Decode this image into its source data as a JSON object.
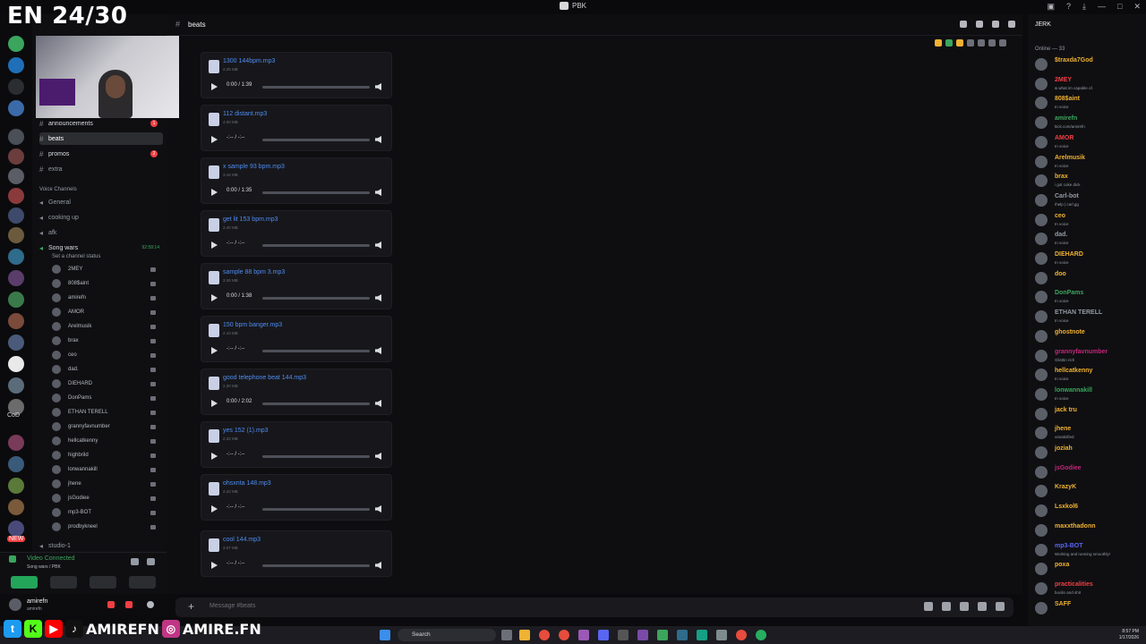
{
  "window": {
    "title": "PBK"
  },
  "overlay": {
    "title": "EN 24/30",
    "socials": [
      "AMIREFN",
      "AMIRE.FN"
    ]
  },
  "servers": {
    "labels": [
      "CoD",
      "NEW"
    ]
  },
  "sidebar": {
    "server_name": "PBK",
    "text_channels": [
      {
        "name": "announcements",
        "badge": "1"
      },
      {
        "name": "beats",
        "badge": ""
      },
      {
        "name": "promos",
        "badge": "2"
      },
      {
        "name": "extra",
        "badge": ""
      }
    ],
    "voice_header": "Voice Channels",
    "voice_channels": [
      "General",
      "cooking up",
      "afk"
    ],
    "song_wars": {
      "name": "Song wars",
      "timer": "92:58:14",
      "status": "Set a channel status"
    },
    "voice_users": [
      "2MEY",
      "808$aint",
      "amirefn",
      "AMOR",
      "Arelmusik",
      "brax",
      "ceo",
      "dad.",
      "DIEHARD",
      "DonPams",
      "ETHAN TERELL",
      "grannyfavnumber",
      "hellcatkenny",
      "highbrild",
      "lonwannakill",
      "jhene",
      "jsGodiee",
      "mp3-BOT",
      "prodbykneel"
    ],
    "extra_channel": "studio-1"
  },
  "voice_panel": {
    "status": "Video Connected",
    "channel": "Song wars / PBK"
  },
  "user_panel": {
    "name": "amirefn",
    "sub": "amirefn"
  },
  "main": {
    "channel_name": "beats",
    "composer_placeholder": "Message #beats",
    "attachments": [
      {
        "file": "1300 144bpm.mp3",
        "size": "2.25 MB",
        "time": "0:00 / 1:39",
        "progress": 0.0
      },
      {
        "file": "112 distant.mp3",
        "size": "4.00 MB",
        "time": "-:-- / -:--",
        "progress": 0.0
      },
      {
        "file": "x sample 93 bpm.mp3",
        "size": "3.16 MB",
        "time": "0:00 / 1:35",
        "progress": 0.0
      },
      {
        "file": "get lit 153 bpm.mp3",
        "size": "2.40 MB",
        "time": "-:-- / -:--",
        "progress": 0.0
      },
      {
        "file": "sample 88 bpm 3.mp3",
        "size": "3.26 MB",
        "time": "0:00 / 1:38",
        "progress": 0.0
      },
      {
        "file": "150 bpm banger.mp3",
        "size": "2.10 MB",
        "time": "-:-- / -:--",
        "progress": 0.0
      },
      {
        "file": "good telephone beat 144.mp3",
        "size": "2.30 MB",
        "time": "0:00 / 2:02",
        "progress": 0.0
      },
      {
        "file": "yes 152 (1).mp3",
        "size": "2.32 MB",
        "time": "-:-- / -:--",
        "progress": 0.0
      },
      {
        "file": "ohsxnta 148.mp3",
        "size": "2.22 MB",
        "time": "-:-- / -:--",
        "progress": 0.0
      },
      {
        "file": "cool 144.mp3",
        "size": "3.07 MB",
        "time": "-:-- / -:--",
        "progress": 0.0
      }
    ]
  },
  "members": {
    "header": "JERK",
    "online_label": "Online — 33",
    "list": [
      {
        "name": "$traxda7God",
        "status": "",
        "color": "#f0b232"
      },
      {
        "name": "2MEY",
        "status": "& what im capable of.",
        "color": "#f23f43"
      },
      {
        "name": "808$aint",
        "status": "In voice",
        "color": "#f0b232"
      },
      {
        "name": "amirefn",
        "status": "kick.com/amirefn",
        "color": "#3ba55d"
      },
      {
        "name": "AMOR",
        "status": "In voice",
        "color": "#f23f43"
      },
      {
        "name": "Arelmusik",
        "status": "In voice",
        "color": "#f0b232"
      },
      {
        "name": "brax",
        "status": "i got coke dick",
        "color": "#f0b232"
      },
      {
        "name": "Carl-bot",
        "status": "/help | carl.gg",
        "color": "#949ba4"
      },
      {
        "name": "ceo",
        "status": "In voice",
        "color": "#f0b232"
      },
      {
        "name": "dad.",
        "status": "In voice",
        "color": "#949ba4"
      },
      {
        "name": "DIEHARD",
        "status": "In voice",
        "color": "#f0b232"
      },
      {
        "name": "doo",
        "status": "",
        "color": "#f0b232"
      },
      {
        "name": "DonPams",
        "status": "In voice",
        "color": "#3ba55d"
      },
      {
        "name": "ETHAN TERELL",
        "status": "In voice",
        "color": "#949ba4"
      },
      {
        "name": "ghostnote",
        "status": "",
        "color": "#f0b232"
      },
      {
        "name": "grannyfavnumber",
        "status": "Glisttin rich",
        "color": "#c4267a"
      },
      {
        "name": "hellcatkenny",
        "status": "In voice",
        "color": "#f0b232"
      },
      {
        "name": "lonwannakill",
        "status": "In voice",
        "color": "#3ba55d"
      },
      {
        "name": "jack tru",
        "status": "",
        "color": "#f0b232"
      },
      {
        "name": "jhene",
        "status": "unsatisfied",
        "color": "#f0b232"
      },
      {
        "name": "joziah",
        "status": "",
        "color": "#f0b232"
      },
      {
        "name": "jsGodiee",
        "status": "",
        "color": "#c4267a"
      },
      {
        "name": "KrazyK",
        "status": "",
        "color": "#f0b232"
      },
      {
        "name": "Lsxkol6",
        "status": "",
        "color": "#f0b232"
      },
      {
        "name": "maxxthadonn",
        "status": "",
        "color": "#f0b232"
      },
      {
        "name": "mp3-BOT",
        "status": "Working and running smoothly!",
        "color": "#5865f2"
      },
      {
        "name": "poxa",
        "status": "",
        "color": "#f0b232"
      },
      {
        "name": "practicalities",
        "status": "boolin and shit",
        "color": "#f23f43"
      },
      {
        "name": "SAFF",
        "status": "",
        "color": "#f0b232"
      }
    ]
  },
  "taskbar": {
    "search": "Search",
    "time": "8:57 PM",
    "date": "1/17/2026"
  },
  "colors": {
    "accent": "#5865f2",
    "link": "#4e8cf0",
    "online": "#23a55a"
  }
}
